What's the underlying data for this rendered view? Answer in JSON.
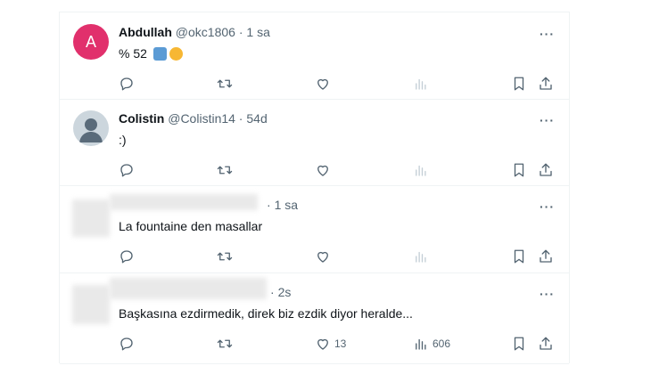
{
  "tweets": [
    {
      "name": "Abdullah",
      "handle": "@okc1806",
      "sep": " · ",
      "time": "1 sa",
      "text": "% 52",
      "avatar_letter": "A",
      "avatar_color": "#e1306c",
      "replies": "",
      "retweets": "",
      "likes": "",
      "views": ""
    },
    {
      "name": "Colistin",
      "handle": "@Colistin14",
      "sep": " · ",
      "time": "54d",
      "text": ":)",
      "replies": "",
      "retweets": "",
      "likes": "",
      "views": ""
    },
    {
      "sep": "· ",
      "time": "1 sa",
      "text": "La fountaine den masallar",
      "replies": "",
      "retweets": "",
      "likes": "",
      "views": ""
    },
    {
      "sep": "· ",
      "time": "2s",
      "text": "Başkasına ezdirmedik, direk biz ezdik diyor heralde...",
      "replies": "",
      "retweets": "",
      "likes": "13",
      "views": "606"
    }
  ],
  "more_glyph": "···",
  "icons": [
    "reply-icon",
    "retweet-icon",
    "like-icon",
    "views-icon",
    "bookmark-icon",
    "share-icon"
  ],
  "colors": {
    "muted": "#536471",
    "border": "#eff3f4",
    "avatar_pink": "#e1306c"
  }
}
